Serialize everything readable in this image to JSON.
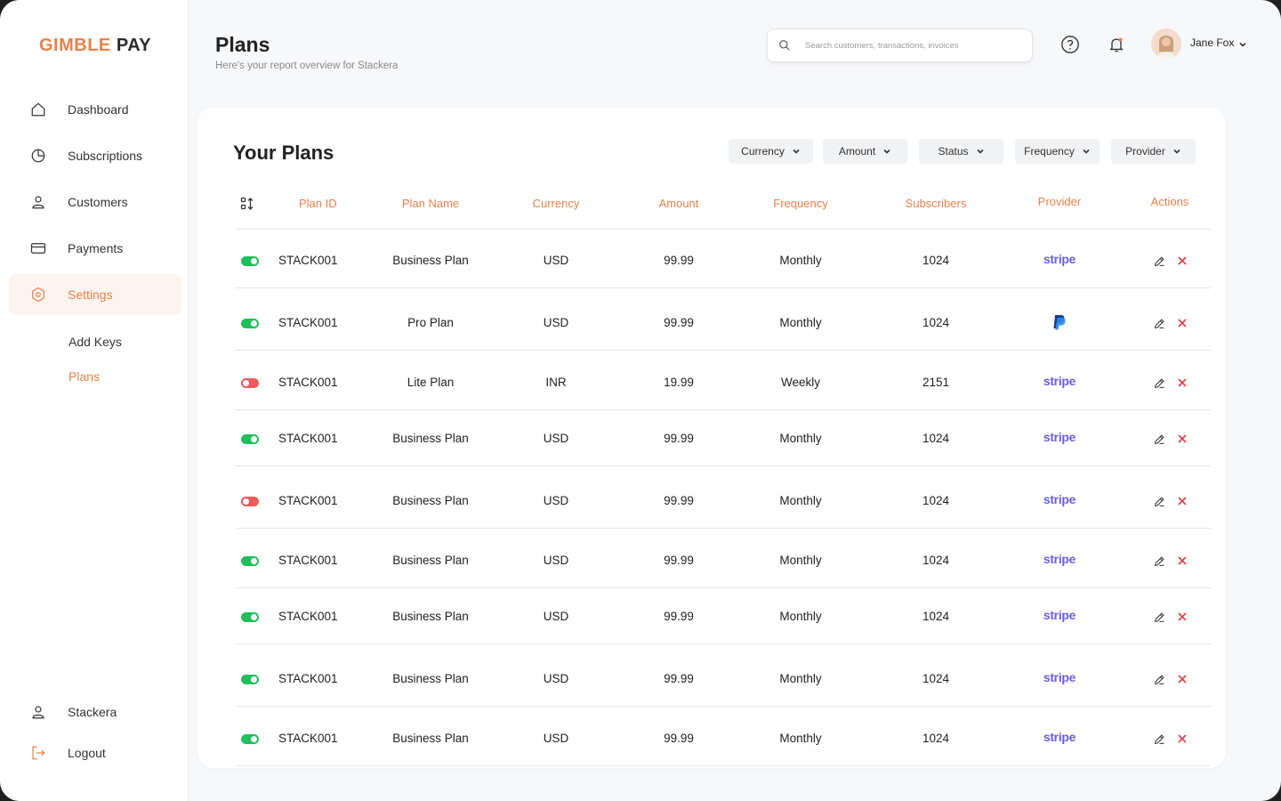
{
  "brand": {
    "part1": "GIMBLE",
    "part2": " PAY"
  },
  "sidebar": {
    "items": [
      {
        "label": "Dashboard",
        "icon": "home-icon"
      },
      {
        "label": "Subscriptions",
        "icon": "pie-chart-icon"
      },
      {
        "label": "Customers",
        "icon": "user-icon"
      },
      {
        "label": "Payments",
        "icon": "card-icon"
      },
      {
        "label": "Settings",
        "icon": "settings-icon",
        "active": true
      }
    ],
    "sub_items": [
      {
        "label": "Add Keys"
      },
      {
        "label": "Plans",
        "active": true
      }
    ],
    "bottom": [
      {
        "label": "Stackera",
        "icon": "user-icon"
      },
      {
        "label": "Logout",
        "icon": "logout-icon"
      }
    ]
  },
  "header": {
    "title": "Plans",
    "subtitle": "Here's your report overview for Stackera",
    "search_placeholder": "Search customers, transactions, invoices",
    "user_name": "Jane Fox"
  },
  "card": {
    "title": "Your Plans",
    "filters": [
      "Currency",
      "Amount",
      "Status",
      "Frequency",
      "Provider"
    ],
    "columns": [
      "Plan ID",
      "Plan Name",
      "Currency",
      "Amount",
      "Frequency",
      "Subscribers",
      "Provider",
      "Actions"
    ],
    "rows": [
      {
        "active": true,
        "plan_id": "STACK001",
        "plan_name": "Business Plan",
        "currency": "USD",
        "amount": "99.99",
        "frequency": "Monthly",
        "subscribers": "1024",
        "provider": "stripe"
      },
      {
        "active": true,
        "plan_id": "STACK001",
        "plan_name": "Pro Plan",
        "currency": "USD",
        "amount": "99.99",
        "frequency": "Monthly",
        "subscribers": "1024",
        "provider": "paypal"
      },
      {
        "active": false,
        "plan_id": "STACK001",
        "plan_name": "Lite Plan",
        "currency": "INR",
        "amount": "19.99",
        "frequency": "Weekly",
        "subscribers": "2151",
        "provider": "stripe"
      },
      {
        "active": true,
        "plan_id": "STACK001",
        "plan_name": "Business Plan",
        "currency": "USD",
        "amount": "99.99",
        "frequency": "Monthly",
        "subscribers": "1024",
        "provider": "stripe"
      },
      {
        "active": false,
        "plan_id": "STACK001",
        "plan_name": "Business Plan",
        "currency": "USD",
        "amount": "99.99",
        "frequency": "Monthly",
        "subscribers": "1024",
        "provider": "stripe"
      },
      {
        "active": true,
        "plan_id": "STACK001",
        "plan_name": "Business Plan",
        "currency": "USD",
        "amount": "99.99",
        "frequency": "Monthly",
        "subscribers": "1024",
        "provider": "stripe"
      },
      {
        "active": true,
        "plan_id": "STACK001",
        "plan_name": "Business Plan",
        "currency": "USD",
        "amount": "99.99",
        "frequency": "Monthly",
        "subscribers": "1024",
        "provider": "stripe"
      },
      {
        "active": true,
        "plan_id": "STACK001",
        "plan_name": "Business Plan",
        "currency": "USD",
        "amount": "99.99",
        "frequency": "Monthly",
        "subscribers": "1024",
        "provider": "stripe"
      },
      {
        "active": true,
        "plan_id": "STACK001",
        "plan_name": "Business Plan",
        "currency": "USD",
        "amount": "99.99",
        "frequency": "Monthly",
        "subscribers": "1024",
        "provider": "stripe"
      }
    ]
  },
  "colors": {
    "accent": "#e8804a",
    "on": "#1fbf5b",
    "off": "#ee5b5b",
    "stripe": "#6a5fe0",
    "delete": "#e0404a"
  }
}
